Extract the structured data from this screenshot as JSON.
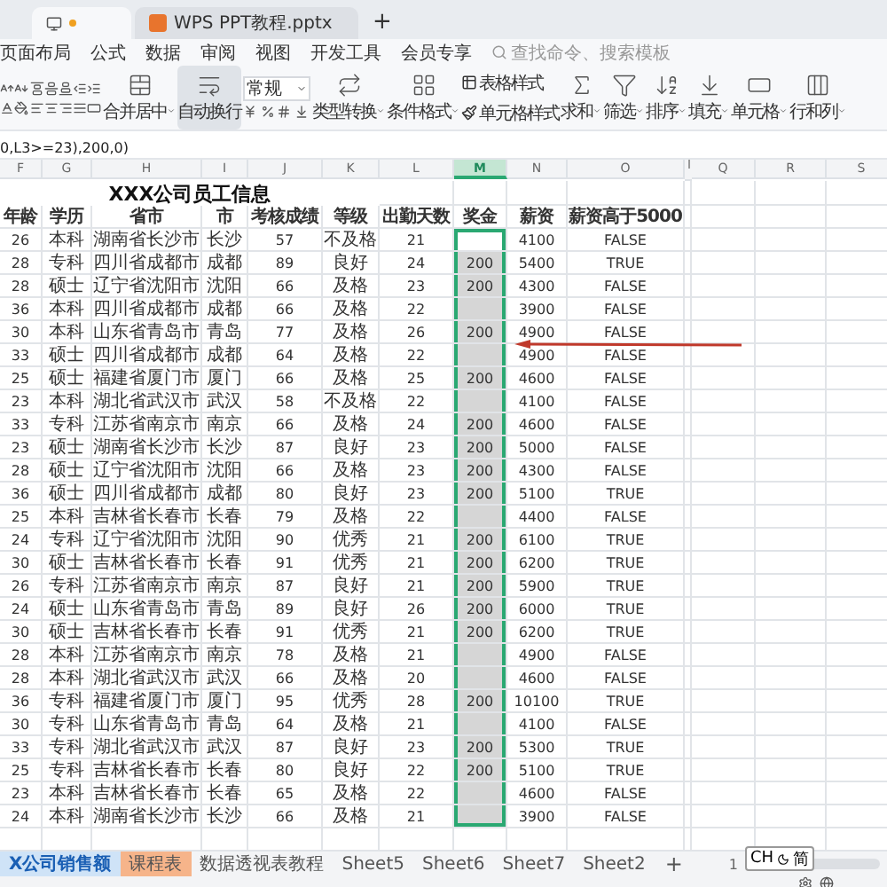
{
  "tabs": [
    {
      "kind": "blank",
      "selected": true
    },
    {
      "kind": "document",
      "label": "WPS PPT教程.pptx",
      "selected": false
    }
  ],
  "new_tab": "+",
  "menu": [
    "页面布局",
    "公式",
    "数据",
    "审阅",
    "视图",
    "开发工具",
    "会员专享"
  ],
  "search": {
    "placeholder": "查找命令、搜索模板"
  },
  "toolbar": {
    "number_format": "常规",
    "buttons": [
      {
        "kind": "merge",
        "label": "合并居中",
        "dropdown": true,
        "pressed": false
      },
      {
        "kind": "wrap",
        "label": "自动换行",
        "dropdown": false,
        "pressed": true
      }
    ],
    "buttons_2": [
      {
        "kind": "convert",
        "label": "类型转换",
        "dropdown": true,
        "pressed": false
      },
      {
        "kind": "conditional",
        "label": "条件格式",
        "dropdown": true,
        "pressed": false
      }
    ],
    "styles": [
      {
        "kind": "table",
        "label": "表格样式"
      },
      {
        "kind": "cell",
        "label": "单元格样式"
      }
    ],
    "buttons_3": [
      {
        "kind": "sum",
        "label": "求和",
        "dropdown": true,
        "pressed": false
      },
      {
        "kind": "filter",
        "label": "筛选",
        "dropdown": true,
        "pressed": false
      },
      {
        "kind": "sort",
        "label": "排序",
        "dropdown": true,
        "pressed": false
      },
      {
        "kind": "fill",
        "label": "填充",
        "dropdown": true,
        "pressed": false
      },
      {
        "kind": "cells",
        "label": "单元格",
        "dropdown": true,
        "pressed": false
      },
      {
        "kind": "rowscols",
        "label": "行和列",
        "dropdown": true,
        "pressed": false
      }
    ]
  },
  "formula_bar": {
    "formula": "0,L3>=23),200,0)"
  },
  "table": {
    "title": "XXX公司员工信息",
    "columns": [
      {
        "kind": "letter",
        "letter": "F",
        "selected": false
      },
      {
        "kind": "letter",
        "letter": "G",
        "selected": false
      },
      {
        "kind": "letter",
        "letter": "H",
        "selected": false
      },
      {
        "kind": "letter",
        "letter": "I",
        "selected": false
      },
      {
        "kind": "letter",
        "letter": "J",
        "selected": false
      },
      {
        "kind": "letter",
        "letter": "K",
        "selected": false
      },
      {
        "kind": "letter",
        "letter": "L",
        "selected": false
      },
      {
        "kind": "letter",
        "letter": "M",
        "selected": true
      },
      {
        "kind": "letter",
        "letter": "N",
        "selected": false
      },
      {
        "kind": "letter",
        "letter": "O",
        "selected": false
      },
      {
        "kind": "collapsed"
      },
      {
        "kind": "letter",
        "letter": "Q",
        "selected": false
      },
      {
        "kind": "letter",
        "letter": "R",
        "selected": false
      },
      {
        "kind": "letter",
        "letter": "S",
        "selected": false
      }
    ],
    "headers": [
      "年龄",
      "学历",
      "省市",
      "市",
      "考核成绩",
      "等级",
      "出勤天数",
      "奖金",
      "薪资",
      "薪资高于5000"
    ],
    "rows": [
      {
        "active": true,
        "cells": [
          "26",
          "本科",
          "湖南省长沙市",
          "长沙",
          "57",
          "不及格",
          "21",
          "",
          "4100",
          "FALSE"
        ]
      },
      {
        "active": false,
        "cells": [
          "28",
          "专科",
          "四川省成都市",
          "成都",
          "89",
          "良好",
          "24",
          "200",
          "5400",
          "TRUE"
        ]
      },
      {
        "active": false,
        "cells": [
          "28",
          "硕士",
          "辽宁省沈阳市",
          "沈阳",
          "66",
          "及格",
          "23",
          "200",
          "4300",
          "FALSE"
        ]
      },
      {
        "active": false,
        "cells": [
          "36",
          "本科",
          "四川省成都市",
          "成都",
          "66",
          "及格",
          "22",
          "",
          "3900",
          "FALSE"
        ]
      },
      {
        "active": false,
        "cells": [
          "30",
          "本科",
          "山东省青岛市",
          "青岛",
          "77",
          "及格",
          "26",
          "200",
          "4900",
          "FALSE"
        ]
      },
      {
        "active": false,
        "cells": [
          "33",
          "硕士",
          "四川省成都市",
          "成都",
          "64",
          "及格",
          "22",
          "",
          "4900",
          "FALSE"
        ]
      },
      {
        "active": false,
        "cells": [
          "25",
          "硕士",
          "福建省厦门市",
          "厦门",
          "66",
          "及格",
          "25",
          "200",
          "4600",
          "FALSE"
        ]
      },
      {
        "active": false,
        "cells": [
          "23",
          "本科",
          "湖北省武汉市",
          "武汉",
          "58",
          "不及格",
          "22",
          "",
          "4100",
          "FALSE"
        ]
      },
      {
        "active": false,
        "cells": [
          "33",
          "专科",
          "江苏省南京市",
          "南京",
          "66",
          "及格",
          "24",
          "200",
          "4600",
          "FALSE"
        ]
      },
      {
        "active": false,
        "cells": [
          "23",
          "硕士",
          "湖南省长沙市",
          "长沙",
          "87",
          "良好",
          "23",
          "200",
          "5000",
          "FALSE"
        ]
      },
      {
        "active": false,
        "cells": [
          "28",
          "硕士",
          "辽宁省沈阳市",
          "沈阳",
          "66",
          "及格",
          "23",
          "200",
          "4300",
          "FALSE"
        ]
      },
      {
        "active": false,
        "cells": [
          "36",
          "硕士",
          "四川省成都市",
          "成都",
          "80",
          "良好",
          "23",
          "200",
          "5100",
          "TRUE"
        ]
      },
      {
        "active": false,
        "cells": [
          "25",
          "本科",
          "吉林省长春市",
          "长春",
          "79",
          "及格",
          "22",
          "",
          "4400",
          "FALSE"
        ]
      },
      {
        "active": false,
        "cells": [
          "24",
          "专科",
          "辽宁省沈阳市",
          "沈阳",
          "90",
          "优秀",
          "21",
          "200",
          "6100",
          "TRUE"
        ]
      },
      {
        "active": false,
        "cells": [
          "30",
          "硕士",
          "吉林省长春市",
          "长春",
          "91",
          "优秀",
          "21",
          "200",
          "6200",
          "TRUE"
        ]
      },
      {
        "active": false,
        "cells": [
          "26",
          "专科",
          "江苏省南京市",
          "南京",
          "87",
          "良好",
          "21",
          "200",
          "5900",
          "TRUE"
        ]
      },
      {
        "active": false,
        "cells": [
          "24",
          "硕士",
          "山东省青岛市",
          "青岛",
          "89",
          "良好",
          "26",
          "200",
          "6000",
          "TRUE"
        ]
      },
      {
        "active": false,
        "cells": [
          "30",
          "硕士",
          "吉林省长春市",
          "长春",
          "91",
          "优秀",
          "21",
          "200",
          "6200",
          "TRUE"
        ]
      },
      {
        "active": false,
        "cells": [
          "28",
          "本科",
          "江苏省南京市",
          "南京",
          "78",
          "及格",
          "21",
          "",
          "4900",
          "FALSE"
        ]
      },
      {
        "active": false,
        "cells": [
          "28",
          "本科",
          "湖北省武汉市",
          "武汉",
          "66",
          "及格",
          "20",
          "",
          "4600",
          "FALSE"
        ]
      },
      {
        "active": false,
        "cells": [
          "36",
          "专科",
          "福建省厦门市",
          "厦门",
          "95",
          "优秀",
          "28",
          "200",
          "10100",
          "TRUE"
        ]
      },
      {
        "active": false,
        "cells": [
          "30",
          "专科",
          "山东省青岛市",
          "青岛",
          "64",
          "及格",
          "21",
          "",
          "4100",
          "FALSE"
        ]
      },
      {
        "active": false,
        "cells": [
          "33",
          "专科",
          "湖北省武汉市",
          "武汉",
          "87",
          "良好",
          "23",
          "200",
          "5300",
          "TRUE"
        ]
      },
      {
        "active": false,
        "cells": [
          "25",
          "专科",
          "吉林省长春市",
          "长春",
          "80",
          "良好",
          "22",
          "200",
          "5100",
          "TRUE"
        ]
      },
      {
        "active": false,
        "cells": [
          "23",
          "本科",
          "吉林省长春市",
          "长春",
          "65",
          "及格",
          "22",
          "",
          "4600",
          "FALSE"
        ]
      },
      {
        "active": false,
        "cells": [
          "24",
          "本科",
          "湖南省长沙市",
          "长沙",
          "66",
          "及格",
          "21",
          "",
          "3900",
          "FALSE"
        ]
      }
    ]
  },
  "sheet_tabs": [
    {
      "label": "X公司销售额",
      "selected": true
    },
    {
      "label": "课程表",
      "selected": false,
      "color": "#f6b48a"
    },
    {
      "label": "数据透视表教程",
      "selected": false
    },
    {
      "label": "Sheet5",
      "selected": false
    },
    {
      "label": "Sheet6",
      "selected": false
    },
    {
      "label": "Sheet7",
      "selected": false
    },
    {
      "label": "Sheet2",
      "selected": false
    }
  ],
  "add_sheet": "+",
  "page_nav": "1",
  "ime": {
    "language": "CH",
    "mode": "简"
  }
}
